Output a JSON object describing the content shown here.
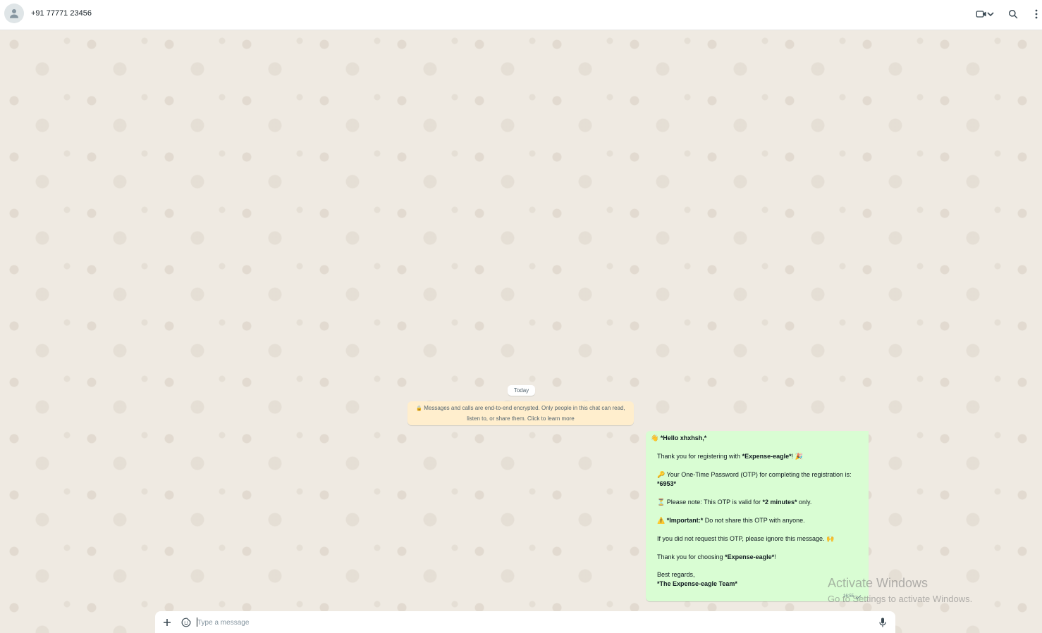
{
  "header": {
    "contact_name": "+91 77771 23456",
    "icons": [
      "person-icon",
      "video-call-icon",
      "chevron-down-icon",
      "search-icon",
      "more-vertical-icon"
    ]
  },
  "chat": {
    "date_chip": "Today",
    "encryption_notice_line1": "Messages and calls are end-to-end encrypted. Only people in this chat can read,",
    "encryption_notice_line2": "listen to, or share them. Click to learn more",
    "message": {
      "greeting_emoji": "👋",
      "greeting": "*Hello xhxhsh,*",
      "thanks_prefix": "Thank you for registering with ",
      "thanks_bold": "*Expense-eagle*",
      "thanks_suffix": "! 🎉",
      "otp_emoji": "🔑",
      "otp_line1": "Your One-Time Password (OTP) for completing the registration is:",
      "otp_code": "*6953*",
      "validity_emoji": "⏳",
      "validity_prefix": "Please note: This OTP is valid for ",
      "validity_bold": "*2 minutes*",
      "validity_suffix": " only.",
      "important_emoji": "⚠️",
      "important_bold": "*Important:*",
      "important_text": " Do not share this OTP with anyone.",
      "ignore_line": "If you did not request this OTP, please ignore this message. 🙌",
      "choosing_prefix": "Thank you for choosing ",
      "choosing_bold": "*Expense-eagle*",
      "choosing_suffix": "!",
      "regards": "Best regards,",
      "team": "*The Expense-eagle Team*",
      "time": "16:55"
    }
  },
  "watermark": {
    "line1": "Activate Windows",
    "line2": "Go to Settings to activate Windows."
  },
  "composer": {
    "placeholder": "Type a message",
    "icons": [
      "plus-icon",
      "sticker-icon",
      "microphone-icon"
    ]
  },
  "colors": {
    "background": "#efeae2",
    "outgoing_bubble": "#d9fdd3",
    "notice_bubble": "#ffeecd"
  }
}
